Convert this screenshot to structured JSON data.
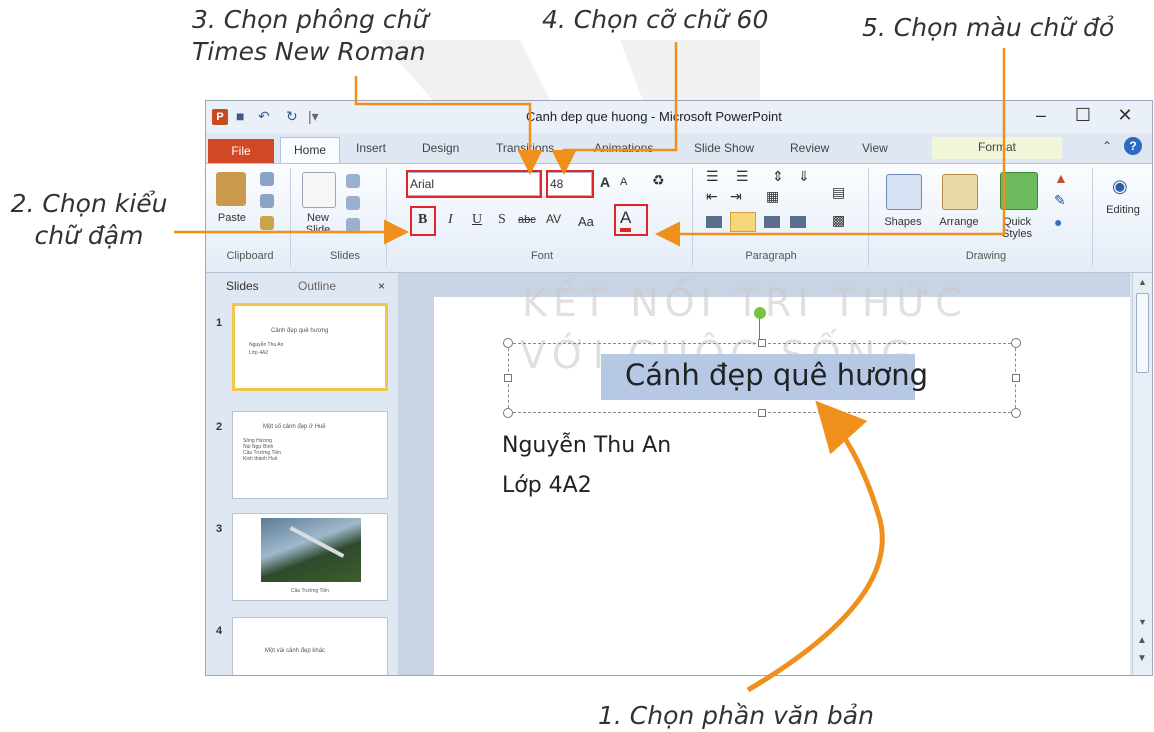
{
  "annotations": {
    "step1": "1. Chọn phần văn bản",
    "step2_line1": "2. Chọn kiểu",
    "step2_line2": "chữ đậm",
    "step3_line1": "3. Chọn phông chữ",
    "step3_line2": "Times New Roman",
    "step4": "4. Chọn cỡ chữ 60",
    "step5": "5. Chọn màu chữ đỏ"
  },
  "window": {
    "title": "Canh dep que huong - Microsoft PowerPoint",
    "app_icon": "P"
  },
  "tabs": [
    "File",
    "Home",
    "Insert",
    "Design",
    "Transitions",
    "Animations",
    "Slide Show",
    "Review",
    "View",
    "Format"
  ],
  "ribbon": {
    "clipboard": {
      "paste": "Paste",
      "label": "Clipboard"
    },
    "slides": {
      "new_slide_1": "New",
      "new_slide_2": "Slide",
      "label": "Slides"
    },
    "font": {
      "font_name": "Arial",
      "font_size": "48",
      "bold": "B",
      "italic": "I",
      "underline": "U",
      "strike": "S",
      "shadow": "abc",
      "spacing": "AV",
      "case": "Aa",
      "color_btn": "A",
      "grow": "A",
      "shrink": "A",
      "label": "Font"
    },
    "paragraph": {
      "label": "Paragraph"
    },
    "drawing": {
      "shapes": "Shapes",
      "arrange": "Arrange",
      "quick_1": "Quick",
      "quick_2": "Styles",
      "label": "Drawing"
    },
    "editing": {
      "label": "Editing"
    }
  },
  "panel": {
    "tab_slides": "Slides",
    "tab_outline": "Outline",
    "close": "×",
    "thumbs": [
      {
        "num": "1",
        "title": "Cảnh đẹp quê hương",
        "lines": [
          "Nguyễn Thu An",
          "Lớp 4A2"
        ]
      },
      {
        "num": "2",
        "title": "Một số cảnh đẹp ở Huế",
        "lines": [
          "Sông Hương",
          "Núi Ngự Bình",
          "Cầu Trường Tiền",
          "Kinh thành Huế"
        ]
      },
      {
        "num": "3",
        "caption": "Cầu Trường Tiền"
      },
      {
        "num": "4",
        "title": "Một vài cảnh đẹp khác"
      }
    ]
  },
  "slide": {
    "title": "Cánh đẹp quê hương",
    "line1": "Nguyễn Thu An",
    "line2": "Lớp 4A2"
  },
  "watermark": {
    "line1": "KẾT NỐI TRI THỨC",
    "line2": "VỚI CUỘC SỐNG"
  },
  "colors": {
    "accent_orange": "#f0901c",
    "highlight_red": "#e0242a",
    "file_tab": "#d24726",
    "selection": "#b6c8e4"
  }
}
